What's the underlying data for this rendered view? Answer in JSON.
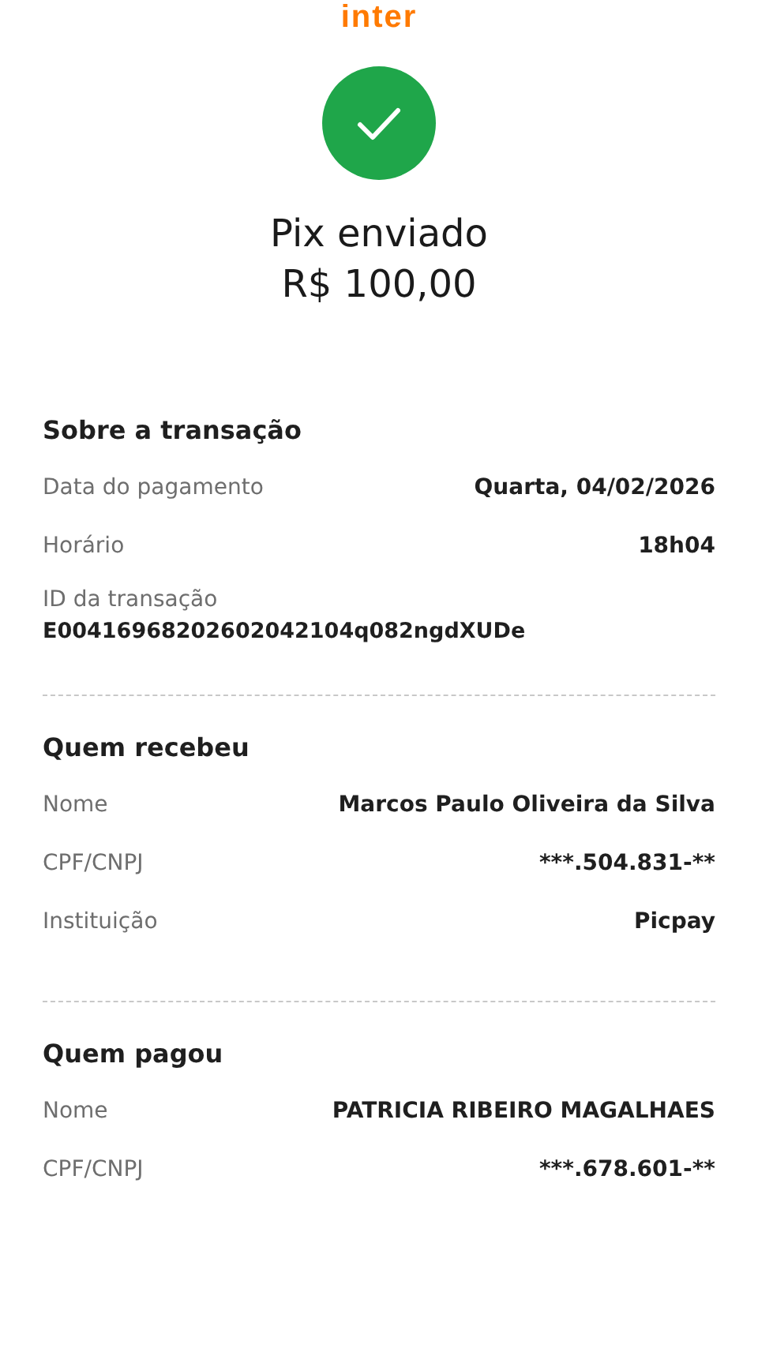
{
  "logo": "inter",
  "status": {
    "title": "Pix enviado",
    "amount": "R$ 100,00"
  },
  "sections": [
    {
      "heading": "Sobre a transação",
      "rows": [
        {
          "kind": "inline",
          "label": "Data do pagamento",
          "value": "Quarta, 04/02/2026"
        },
        {
          "kind": "inline",
          "label": "Horário",
          "value": "18h04"
        },
        {
          "kind": "stacked",
          "label": "ID da transação",
          "value": "E00416968202602042104q082ngdXUDe"
        }
      ]
    },
    {
      "heading": "Quem recebeu",
      "rows": [
        {
          "kind": "inline",
          "label": "Nome",
          "value": "Marcos Paulo Oliveira da Silva"
        },
        {
          "kind": "inline",
          "label": "CPF/CNPJ",
          "value": "***.504.831-**"
        },
        {
          "kind": "inline",
          "label": "Instituição",
          "value": "Picpay"
        }
      ]
    },
    {
      "heading": "Quem pagou",
      "rows": [
        {
          "kind": "inline",
          "label": "Nome",
          "value": "PATRICIA RIBEIRO MAGALHAES"
        },
        {
          "kind": "inline",
          "label": "CPF/CNPJ",
          "value": "***.678.601-**"
        }
      ]
    }
  ]
}
